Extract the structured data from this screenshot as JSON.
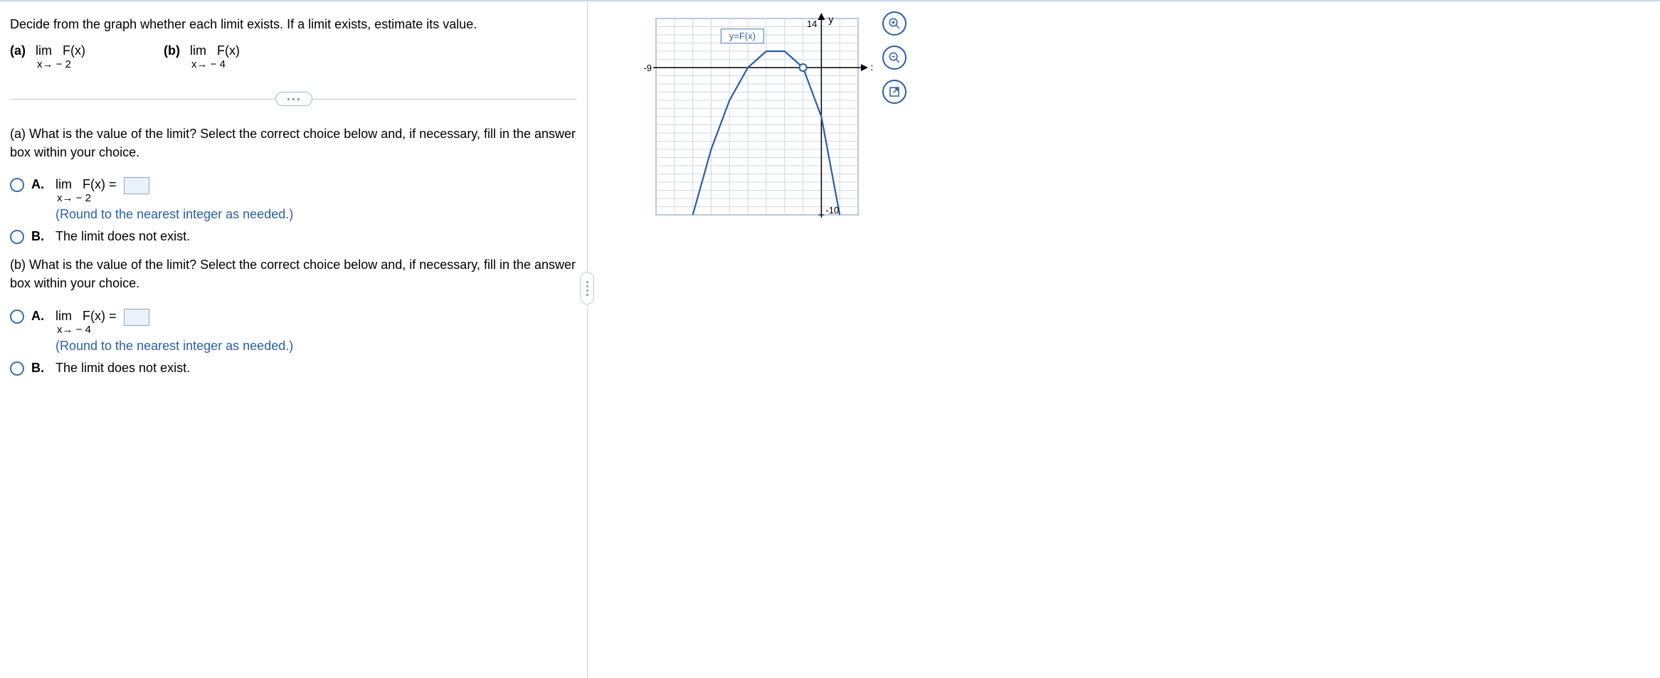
{
  "prompt": "Decide from the graph whether each limit exists. If a limit exists, estimate its value.",
  "parts": {
    "a": {
      "label": "(a)",
      "fn": "F(x)",
      "lim_word": "lim",
      "approach": "x→ − 2"
    },
    "b": {
      "label": "(b)",
      "fn": "F(x)",
      "lim_word": "lim",
      "approach": "x→ − 4"
    }
  },
  "qa": {
    "intro": "(a) What is the value of the limit? Select the correct choice below and, if necessary, fill in the answer box within your choice.",
    "optA_label": "A.",
    "optA_lim_word": "lim",
    "optA_fn": "F(x) =",
    "optA_approach": "x→ − 2",
    "optA_round": "(Round to the nearest integer as needed.)",
    "optB_label": "B.",
    "optB_text": "The limit does not exist."
  },
  "qb": {
    "intro": "(b) What is the value of the limit? Select the correct choice below and, if necessary, fill in the answer box within your choice.",
    "optA_label": "A.",
    "optA_lim_word": "lim",
    "optA_fn": "F(x) =",
    "optA_approach": "x→ − 4",
    "optA_round": "(Round to the nearest integer as needed.)",
    "optB_label": "B.",
    "optB_text": "The limit does not exist."
  },
  "graph": {
    "fn_label": "y=F(x)",
    "x_axis": "x",
    "y_axis": "y",
    "x_min_label": "-9",
    "y_max_label": "14",
    "y_min_label": "-10"
  },
  "chart_data": {
    "type": "line",
    "title": "y=F(x)",
    "xlabel": "x",
    "ylabel": "y",
    "xlim": [
      -9,
      2
    ],
    "ylim": [
      -10,
      14
    ],
    "series": [
      {
        "name": "F(x)",
        "x": [
          -7,
          -6,
          -5,
          -4,
          -3,
          -2.5,
          -2,
          -1.5,
          -1,
          0,
          1
        ],
        "values": [
          -10,
          -2,
          4,
          8,
          10,
          10,
          10,
          9,
          8,
          2,
          -10
        ]
      }
    ],
    "open_point": {
      "x": -1,
      "y": 8
    }
  }
}
